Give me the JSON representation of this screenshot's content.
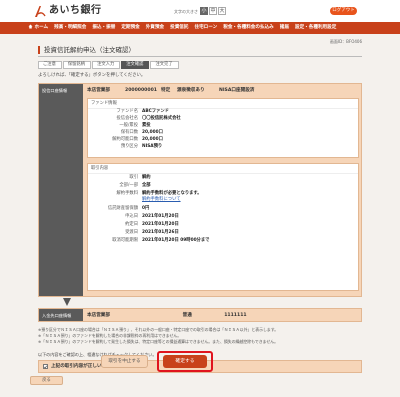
{
  "header": {
    "logo_text": "あいち銀行",
    "font_size_label": "文字の大きさ",
    "font_sizes": [
      "小",
      "中",
      "大"
    ],
    "logout_label": "ログアウト"
  },
  "nav": {
    "items": [
      "ホーム",
      "残高・明細照会",
      "振込・振替",
      "定期預金",
      "外貨預金",
      "投資信託",
      "住宅ローン",
      "税金・各種料金の払込み",
      "諸届",
      "設定・各種利用設定"
    ]
  },
  "page": {
    "screen_id": "画面ID：BFO406",
    "title": "投資信託解約申込（注文確認）",
    "steps": [
      "ご注意",
      "保留銘柄",
      "注文入力",
      "注文確認",
      "注文完了"
    ],
    "active_step": 3,
    "instruction": "よろしければ、「確定する」ボタンを押してください。"
  },
  "fund_account": {
    "side_label": "投信口座情報",
    "branch": "本店営業部",
    "account_no": "2000000001",
    "type": "特定",
    "withholding": "源泉徴収あり",
    "nisa": "NISA口座開設済"
  },
  "fund_info": {
    "heading": "ファンド情報",
    "rows": [
      {
        "k": "ファンド名",
        "v": "ABCファンド"
      },
      {
        "k": "投信会社名",
        "v": "〇〇投信託株式会社"
      },
      {
        "k": "一般/累投",
        "v": "累投"
      },
      {
        "k": "保有口数",
        "v": "20,000口"
      },
      {
        "k": "解約可能口数",
        "v": "20,000口"
      },
      {
        "k": "預り区分",
        "v": "NISA預り"
      }
    ]
  },
  "order_info": {
    "heading": "取引内容",
    "rows": [
      {
        "k": "取引",
        "v": "解約"
      },
      {
        "k": "全部/一部",
        "v": "全部"
      },
      {
        "k": "解約手数料",
        "v": "解約手数料が必要となります。"
      },
      {
        "k": "",
        "v": "解約手数料について",
        "link": true
      },
      {
        "k": "信託財産留保額",
        "v": "0円"
      },
      {
        "k": "申込日",
        "v": "2021年01月20日"
      },
      {
        "k": "約定日",
        "v": "2021年01月20日"
      },
      {
        "k": "受渡日",
        "v": "2021年01月26日"
      },
      {
        "k": "取消可能期限",
        "v": "2021年01月20日 09時00分まで"
      }
    ]
  },
  "deposit_account": {
    "side_label": "入金先口座情報",
    "branch": "本店営業部",
    "type": "普通",
    "account_no": "1111111"
  },
  "notes": [
    "※預り区分でＮＩＳＡ口座の場合は「ＮＩＳＡ預り」、それ以外の一般口座・特定口座での取引の場合は「ＮＩＳＡ以外」と表示します。",
    "※「ＮＩＳＡ預り」のファンドを解約した場合の非課税枠の再利用はできません。",
    "※「ＮＩＳＡ預り」のファンドを解約して発生した損失は、特定口座等との損益通算はできません。また、損失の繰越控除もできません。"
  ],
  "check_note": "以下の内容をご確認の上、相違なければチェックしてください。",
  "confirm_checkbox_label": "上記の取引内容が正しいことを確認しました。",
  "buttons": {
    "cancel": "取引を中止する",
    "confirm": "確定する",
    "back": "戻る"
  },
  "colors": {
    "brand": "#c8411a",
    "panel": "#f6d5b8",
    "side": "#5a5a5a",
    "highlight": "#e0141e"
  }
}
